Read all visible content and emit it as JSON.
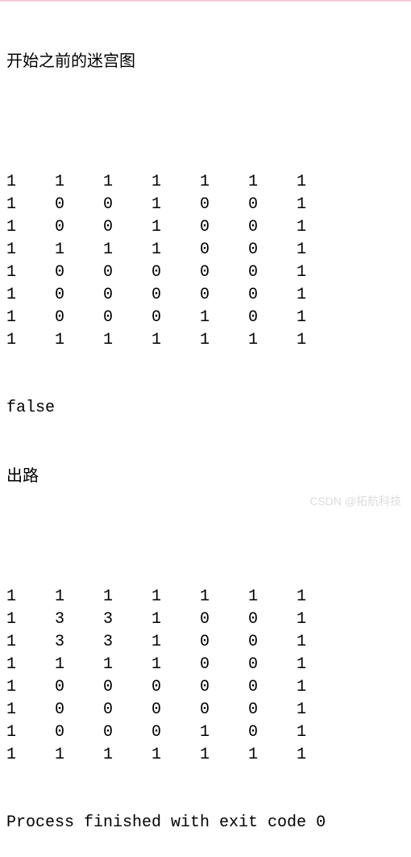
{
  "heading1": "开始之前的迷宫图",
  "grid1": [
    [
      "1",
      "1",
      "1",
      "1",
      "1",
      "1",
      "1"
    ],
    [
      "1",
      "0",
      "0",
      "1",
      "0",
      "0",
      "1"
    ],
    [
      "1",
      "0",
      "0",
      "1",
      "0",
      "0",
      "1"
    ],
    [
      "1",
      "1",
      "1",
      "1",
      "0",
      "0",
      "1"
    ],
    [
      "1",
      "0",
      "0",
      "0",
      "0",
      "0",
      "1"
    ],
    [
      "1",
      "0",
      "0",
      "0",
      "0",
      "0",
      "1"
    ],
    [
      "1",
      "0",
      "0",
      "0",
      "1",
      "0",
      "1"
    ],
    [
      "1",
      "1",
      "1",
      "1",
      "1",
      "1",
      "1"
    ]
  ],
  "bool_result": "false",
  "heading2": "出路",
  "grid2": [
    [
      "1",
      "1",
      "1",
      "1",
      "1",
      "1",
      "1"
    ],
    [
      "1",
      "3",
      "3",
      "1",
      "0",
      "0",
      "1"
    ],
    [
      "1",
      "3",
      "3",
      "1",
      "0",
      "0",
      "1"
    ],
    [
      "1",
      "1",
      "1",
      "1",
      "0",
      "0",
      "1"
    ],
    [
      "1",
      "0",
      "0",
      "0",
      "0",
      "0",
      "1"
    ],
    [
      "1",
      "0",
      "0",
      "0",
      "0",
      "0",
      "1"
    ],
    [
      "1",
      "0",
      "0",
      "0",
      "1",
      "0",
      "1"
    ],
    [
      "1",
      "1",
      "1",
      "1",
      "1",
      "1",
      "1"
    ]
  ],
  "exit_message": "Process finished with exit code 0",
  "watermark": "CSDN @拓航科技"
}
